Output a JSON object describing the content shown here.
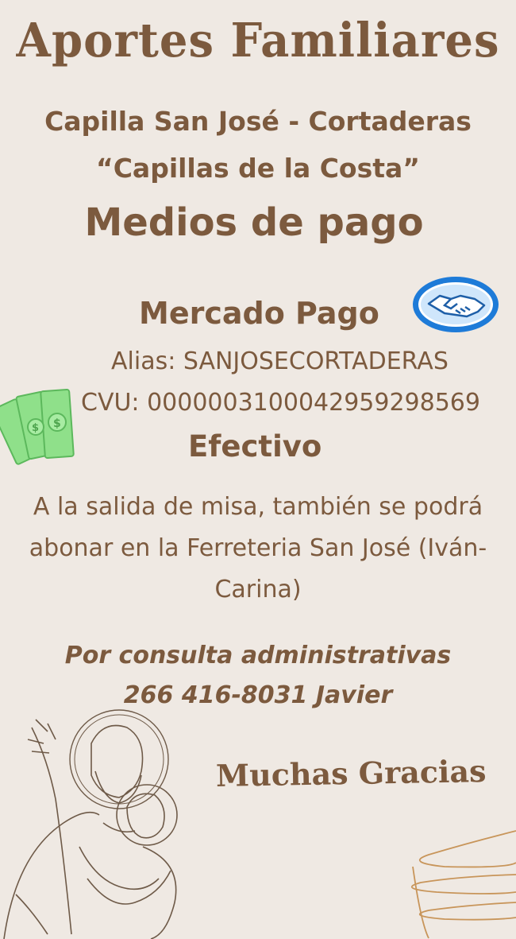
{
  "title": "Aportes Familiares",
  "chapel": "Capilla San José - Cortaderas",
  "subtitle": "“Capillas de la Costa”",
  "medios": "Medios de pago",
  "mercado_pago": {
    "label": "Mercado Pago",
    "alias": "Alias: SANJOSECORTADERAS",
    "cvu": "CVU: 0000003100042959298569"
  },
  "efectivo": {
    "label": "Efectivo",
    "instructions": "A la salida de misa, también se podrá abonar en la Ferreteria San José (Iván- Carina)"
  },
  "consulta": {
    "line1": "Por consulta administrativas",
    "line2": "266 416-8031 Javier"
  },
  "closing": "Muchas Gracias",
  "colors": {
    "background": "#efe9e3",
    "text": "#7c5a3e",
    "mp_blue": "#1e7bd8",
    "money_green": "#8fe08a",
    "swirl": "#c8955a"
  },
  "icons": [
    "mercado-pago-handshake-icon",
    "money-bills-icon",
    "saint-joseph-illustration",
    "decorative-swirl"
  ]
}
